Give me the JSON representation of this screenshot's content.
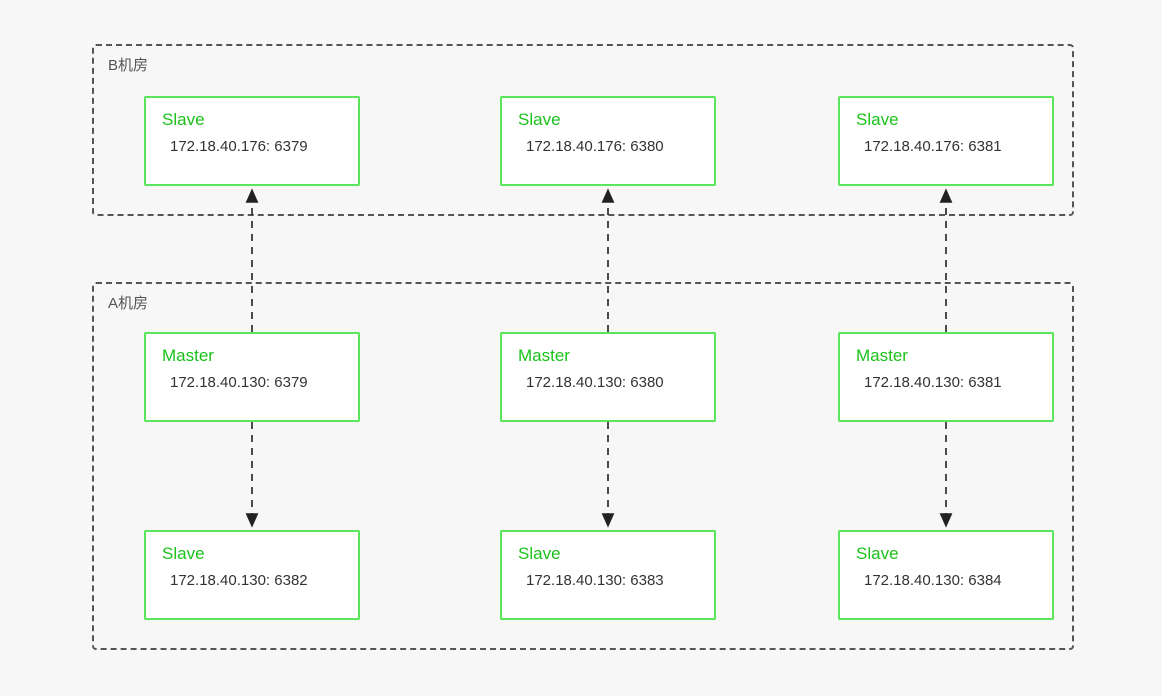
{
  "containers": {
    "top": {
      "label": "B机房"
    },
    "bottom": {
      "label": "A机房"
    }
  },
  "nodes": {
    "b1": {
      "role": "Slave",
      "addr": "172.18.40.176: 6379"
    },
    "b2": {
      "role": "Slave",
      "addr": "172.18.40.176: 6380"
    },
    "b3": {
      "role": "Slave",
      "addr": "172.18.40.176: 6381"
    },
    "a1": {
      "role": "Master",
      "addr": "172.18.40.130: 6379"
    },
    "a2": {
      "role": "Master",
      "addr": "172.18.40.130: 6380"
    },
    "a3": {
      "role": "Master",
      "addr": "172.18.40.130: 6381"
    },
    "s1": {
      "role": "Slave",
      "addr": "172.18.40.130: 6382"
    },
    "s2": {
      "role": "Slave",
      "addr": "172.18.40.130: 6383"
    },
    "s3": {
      "role": "Slave",
      "addr": "172.18.40.130: 6384"
    }
  }
}
